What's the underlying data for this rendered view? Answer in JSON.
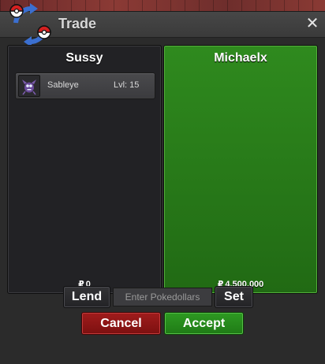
{
  "window": {
    "title": "Trade",
    "close_glyph": "✕"
  },
  "left": {
    "player": "Sussy",
    "items": [
      {
        "name": "Sableye",
        "level": "Lvl: 15",
        "icon": "sableye-icon"
      }
    ],
    "money_symbol": "₽",
    "money": "0"
  },
  "right": {
    "player": "Michaelx",
    "money_symbol": "₽",
    "money": "4,500,000"
  },
  "controls": {
    "lend_label": "Lend",
    "input_placeholder": "Enter Pokedollars",
    "set_label": "Set",
    "cancel_label": "Cancel",
    "accept_label": "Accept"
  },
  "colors": {
    "accent_green": "#2e8a1e",
    "cancel_red": "#8f1616"
  }
}
